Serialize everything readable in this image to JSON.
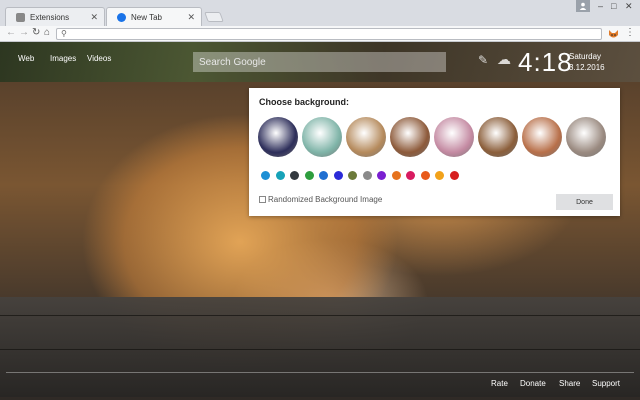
{
  "tabs": [
    {
      "label": "Extensions",
      "active": false
    },
    {
      "label": "New Tab",
      "active": true
    }
  ],
  "icons": {
    "extensions_tab": "puzzle-icon",
    "newtab_tab": "search-logo-icon",
    "back": "back-arrow-icon",
    "forward": "forward-arrow-icon",
    "reload": "reload-icon",
    "home": "home-icon",
    "omnibox_search": "search-icon",
    "extension": "fox-extension-icon",
    "menu": "menu-dots-icon",
    "profile": "profile-icon",
    "pen": "pen-icon",
    "weather": "cloud-icon"
  },
  "omnibox": {
    "value": ""
  },
  "toplinks": {
    "web": "Web",
    "images": "Images",
    "videos": "Videos"
  },
  "search": {
    "placeholder": "Search Google"
  },
  "clock": {
    "time": "4:18",
    "day": "Saturday",
    "date": "3.12.2016"
  },
  "background_panel": {
    "title": "Choose background:",
    "thumbnails": [
      "#2d2e5a",
      "#7fb4a8",
      "#b58a5c",
      "#8d5a3a",
      "#c48aa2",
      "#8b5e3a",
      "#b8704a",
      "#9a8a80"
    ],
    "colors": [
      "#1e8fd5",
      "#17a2b8",
      "#343a40",
      "#2e9e3e",
      "#1f6fd1",
      "#2b2bd8",
      "#6c7a3a",
      "#8a8a8a",
      "#7a1fd1",
      "#e6731e",
      "#d81b60",
      "#e85a1a",
      "#f2a21a",
      "#d62020"
    ],
    "randomize_label": "Randomized Background Image",
    "randomize_checked": false,
    "done_label": "Done"
  },
  "footer": {
    "rate": "Rate",
    "donate": "Donate",
    "share": "Share",
    "support": "Support"
  }
}
